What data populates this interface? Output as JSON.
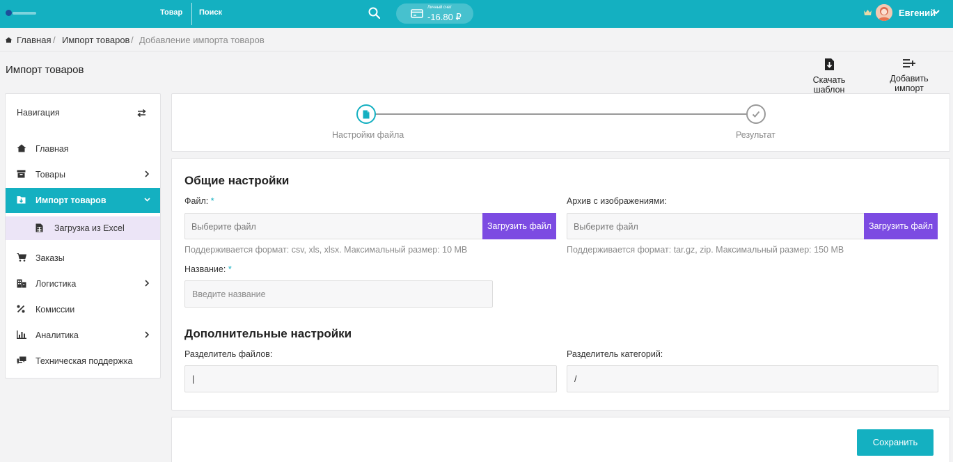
{
  "topbar": {
    "links": [
      "Товар",
      "Поиск"
    ],
    "balance_label": "Личный счет",
    "balance_value": "-16.80 ₽",
    "username": "Евгений"
  },
  "breadcrumb": {
    "items": [
      "Главная",
      "/",
      "Импорт товаров",
      "/",
      "Добавление импорта товаров"
    ]
  },
  "page": {
    "title": "Импорт товаров",
    "actions": [
      "Скачать шаблон",
      "Добавить импорт"
    ]
  },
  "sidebar": {
    "heading": "Навигация",
    "items": [
      {
        "label": "Главная",
        "icon": "home-icon"
      },
      {
        "label": "Товары",
        "icon": "box-icon"
      },
      {
        "label": "Импорт товаров",
        "icon": "import-icon"
      },
      {
        "label": "Загрузка из Excel",
        "icon": "spreadsheet-icon"
      },
      {
        "label": "Заказы",
        "icon": "cart-icon"
      },
      {
        "label": "Логистика",
        "icon": "building-icon"
      },
      {
        "label": "Комиссии",
        "icon": "percent-icon"
      },
      {
        "label": "Аналитика",
        "icon": "bar-chart-icon"
      },
      {
        "label": "Техническая поддержка",
        "icon": "chat-icon"
      }
    ]
  },
  "stepper": {
    "steps": [
      "Настройки файла",
      "Результат"
    ]
  },
  "general": {
    "title": "Общие настройки",
    "file_label": "Файл:",
    "required_mark": "*",
    "file_placeholder": "Выберите файл",
    "upload_label": "Загрузить файл",
    "file_hint": "Поддерживается формат: csv, xls, xlsx. Максимальный размер: 10 MB",
    "archive_label": "Архив с изображениями:",
    "archive_placeholder": "Выберите файл",
    "archive_upload_label": "Загрузить файл",
    "archive_hint": "Поддерживается формат: tar.gz, zip. Максимальный размер: 150 MB",
    "name_label": "Название:",
    "name_placeholder": "Введите название"
  },
  "extra": {
    "title": "Дополнительные настройки",
    "file_sep_label": "Разделитель файлов:",
    "file_sep_value": "|",
    "cat_sep_label": "Разделитель категорий:",
    "cat_sep_value": "/"
  },
  "footer": {
    "save_label": "Сохранить"
  },
  "colors": {
    "accent": "#14b0c1",
    "upload_button": "#7c4be2",
    "active_sub_bg": "#ece5f7"
  }
}
